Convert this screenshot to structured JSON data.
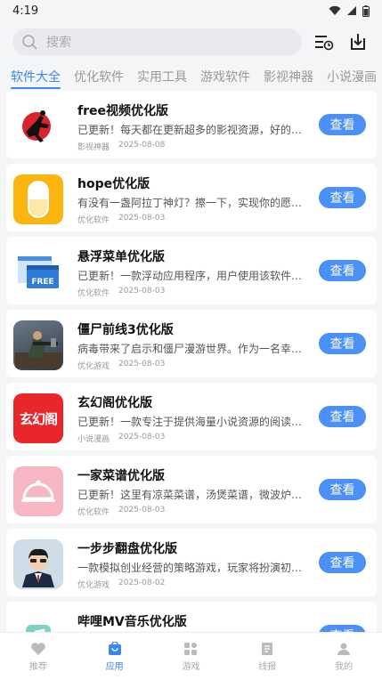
{
  "status": {
    "time": "4:19"
  },
  "search": {
    "placeholder": "搜索"
  },
  "tabs": [
    "软件大全",
    "优化软件",
    "实用工具",
    "游戏软件",
    "影视神器",
    "小说漫画"
  ],
  "items": [
    {
      "title": "free视频优化版",
      "desc": "已更新！每天都在更新超多的影视资源，好的影视资源",
      "category": "影视神器",
      "date": "2025-08-08",
      "button": "查看",
      "icon": "kungfu-silhouette-icon"
    },
    {
      "title": "hope优化版",
      "desc": "有没有一盏阿拉丁神灯？擦一下，实现你的愿望：就这样",
      "category": "优化软件",
      "date": "2025-08-03",
      "button": "查看",
      "icon": "capsule-icon"
    },
    {
      "title": "悬浮菜单优化版",
      "desc": "已更新！一款浮动应用程序，用户使用该软件就可以随时",
      "category": "优化软件",
      "date": "2025-08-03",
      "button": "查看",
      "icon": "free-window-icon",
      "icon_text": "FREE"
    },
    {
      "title": "僵尸前线3优化版",
      "desc": "病毒带来了启示和僵尸漫游世界。作为一名幸存者，你需要",
      "category": "优化游戏",
      "date": "2025-08-03",
      "button": "查看",
      "icon": "soldier-game-icon"
    },
    {
      "title": "玄幻阁优化版",
      "desc": "已更新！一款专注于提供海量小说资源的阅读软件，这里有",
      "category": "小说漫画",
      "date": "2025-08-03",
      "button": "查看",
      "icon": "xuanhuange-logo-icon",
      "icon_text": "玄幻阁"
    },
    {
      "title": "一家菜谱优化版",
      "desc": "已更新！这里有凉菜菜谱，汤煲菜谱，微波炉菜谱，素菜",
      "category": "优化软件",
      "date": "2025-08-03",
      "button": "查看",
      "icon": "food-cloche-icon"
    },
    {
      "title": "一步步翻盘优化版",
      "desc": "一款模拟创业经营的策略游戏，玩家将扮演初创公司老板",
      "category": "优化游戏",
      "date": "2025-08-02",
      "button": "查看",
      "icon": "cartoon-businessman-icon"
    },
    {
      "title": "哔哩MV音乐优化版",
      "desc": "",
      "category": "",
      "date": "",
      "button": "查看",
      "icon": "music-app-icon"
    }
  ],
  "bottom_nav": [
    {
      "label": "推荐",
      "icon": "heart-icon"
    },
    {
      "label": "应用",
      "icon": "app-bag-icon"
    },
    {
      "label": "游戏",
      "icon": "grid-icon"
    },
    {
      "label": "线报",
      "icon": "document-icon"
    },
    {
      "label": "我的",
      "icon": "person-icon"
    }
  ],
  "colors": {
    "accent": "#3b87f2",
    "button": "#4a90f5"
  }
}
